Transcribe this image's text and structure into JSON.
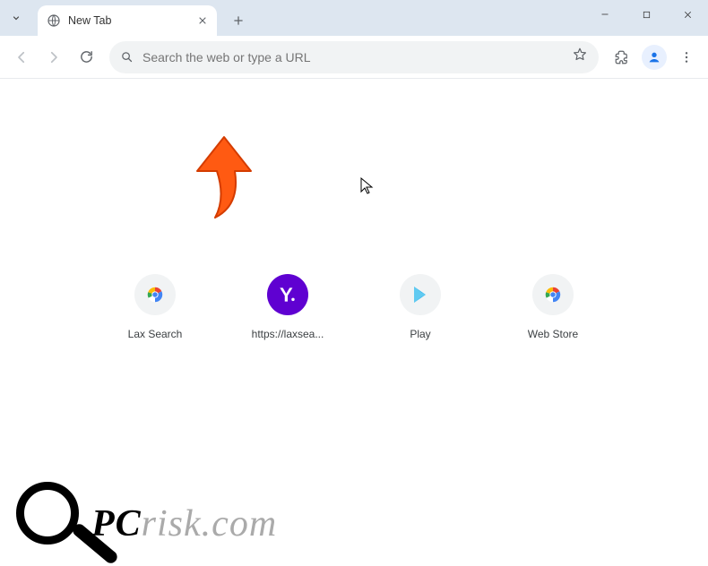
{
  "tab": {
    "title": "New Tab"
  },
  "omnibox": {
    "placeholder": "Search the web or type a URL"
  },
  "shortcuts": [
    {
      "label": "Lax Search",
      "icon": "globe-color"
    },
    {
      "label": "https://laxsea...",
      "icon": "yahoo"
    },
    {
      "label": "Play",
      "icon": "play-store"
    },
    {
      "label": "Web Store",
      "icon": "globe-color"
    }
  ],
  "watermark": {
    "prefix": "PC",
    "mid": "risk",
    "suffix": ".com"
  }
}
